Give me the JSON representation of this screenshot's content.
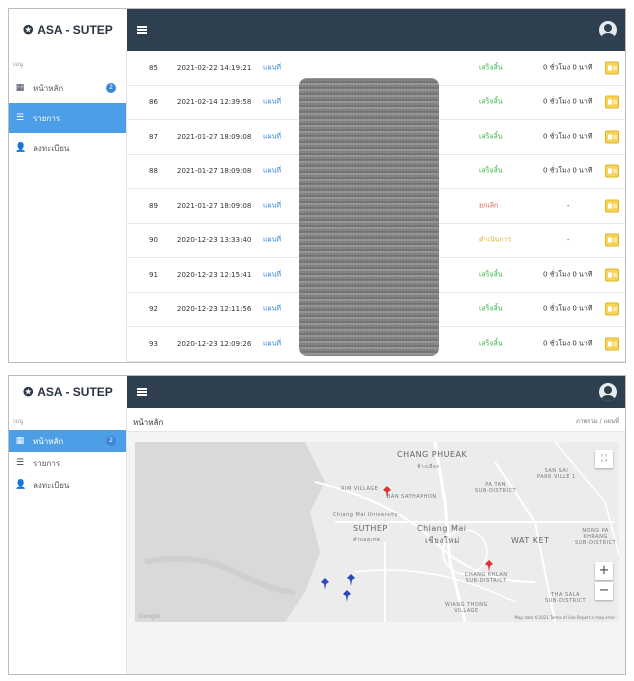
{
  "app": {
    "brand": "ASA - SUTEP",
    "brand_icon": "asa-logo-icon"
  },
  "sidebar": {
    "menu_title": "เมนู",
    "items": [
      {
        "label": "หน้าหลัก",
        "icon": "dashboard-icon",
        "badge": "2"
      },
      {
        "label": "รายการ",
        "icon": "list-icon"
      },
      {
        "label": "ลงทะเบียน",
        "icon": "add-user-icon"
      }
    ]
  },
  "table": {
    "rows": [
      {
        "id": "85",
        "date": "2021-02-22 14:19:21",
        "map": "แผนที่",
        "status": "เสร็จสิ้น",
        "status_type": "ok",
        "duration": "0 ชั่วโมง 0 นาที"
      },
      {
        "id": "86",
        "date": "2021-02-14 12:39:58",
        "map": "แผนที่",
        "status": "เสร็จสิ้น",
        "status_type": "ok",
        "duration": "0 ชั่วโมง 0 นาที"
      },
      {
        "id": "87",
        "date": "2021-01-27 18:09:08",
        "map": "แผนที่",
        "status": "เสร็จสิ้น",
        "status_type": "ok",
        "duration": "0 ชั่วโมง 0 นาที"
      },
      {
        "id": "88",
        "date": "2021-01-27 18:09:08",
        "map": "แผนที่",
        "status": "เสร็จสิ้น",
        "status_type": "ok",
        "duration": "0 ชั่วโมง 0 นาที"
      },
      {
        "id": "89",
        "date": "2021-01-27 18:09:08",
        "map": "แผนที่",
        "status": "ยกเลิก",
        "status_type": "red",
        "duration": "-"
      },
      {
        "id": "90",
        "date": "2020-12-23 13:33:40",
        "map": "แผนที่",
        "status": "ดำเนินการ",
        "status_type": "yel",
        "duration": "-"
      },
      {
        "id": "91",
        "date": "2020-12-23 12:15:41",
        "map": "แผนที่",
        "status": "เสร็จสิ้น",
        "status_type": "ok",
        "duration": "0 ชั่วโมง 0 นาที"
      },
      {
        "id": "92",
        "date": "2020-12-23 12:11:56",
        "map": "แผนที่",
        "status": "เสร็จสิ้น",
        "status_type": "ok",
        "duration": "0 ชั่วโมง 0 นาที"
      },
      {
        "id": "93",
        "date": "2020-12-23 12:09:26",
        "map": "แผนที่",
        "status": "เสร็จสิ้น",
        "status_type": "ok",
        "duration": "0 ชั่วโมง 0 นาที"
      }
    ]
  },
  "dashboard": {
    "title": "หน้าหลัก",
    "breadcrumb": "ภาพรวม / แผนที่",
    "map": {
      "labels": {
        "chang_phueak": "CHANG PHUEAK",
        "chang_phueak_th": "ช้างเผือก",
        "san_sai": "SAN SAI\nPARK VILLE 1",
        "pa_tan": "PA TAN\nSUB-DISTRICT",
        "rim_village": "RIM VILLAGE",
        "ban_sathaphon": "BAN SATHAPHON",
        "cmu": "Chiang Mai University",
        "suthep": "SUTHEP",
        "suthep_th": "ตำบลสุเทพ",
        "chiang_mai": "Chiang Mai",
        "chiang_mai_th": "เชียงใหม่",
        "wat_ket": "WAT KET",
        "nong_pa": "NONG PA\nKHRANG\nSUB-DISTRICT",
        "chang_khlan": "CHANG KHLAN\nSUB-DISTRICT",
        "tha_sala": "THA SALA\nSUB-DISTRICT",
        "wiang_thong": "WIANG THONG\nVILLAGE"
      },
      "zoom_in": "+",
      "zoom_out": "−",
      "fullscreen": "⛶",
      "google": "Google",
      "attribution": "Map data ©2021  Terms of Use  Report a map error"
    }
  },
  "colors": {
    "topbar": "#2e4050",
    "active": "#4c9fe6",
    "ok": "#3bb54a",
    "cancel": "#e0574b",
    "pending": "#e0b430",
    "view_button": "#f7d458"
  }
}
